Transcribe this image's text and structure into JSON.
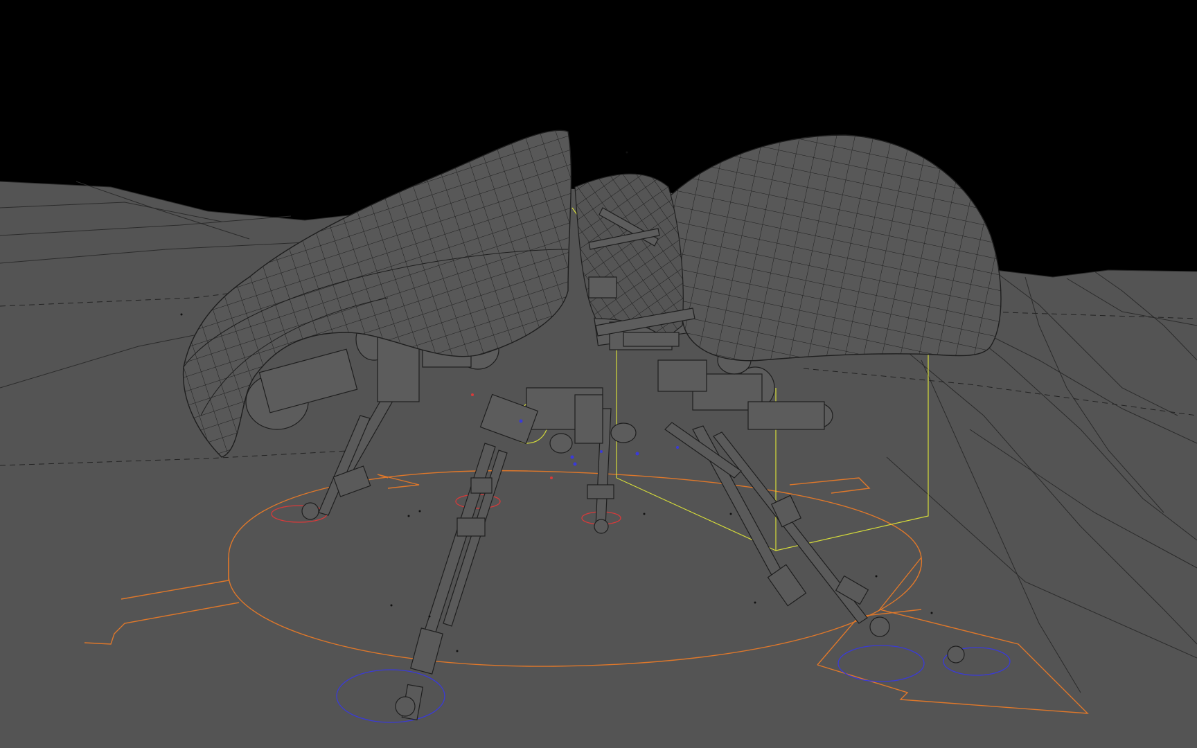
{
  "viewport": {
    "mode": "wireframe",
    "colors": {
      "sky": "#000000",
      "ground": "#545454",
      "mesh_fill": "#565656",
      "mesh_line": "#1e1e1e",
      "ground_line": "#2a2a2a",
      "control_orange": "#e0782a",
      "control_yellow": "#d6dc3a",
      "control_blue": "#3a3ad8",
      "control_red": "#d83a3a"
    }
  }
}
